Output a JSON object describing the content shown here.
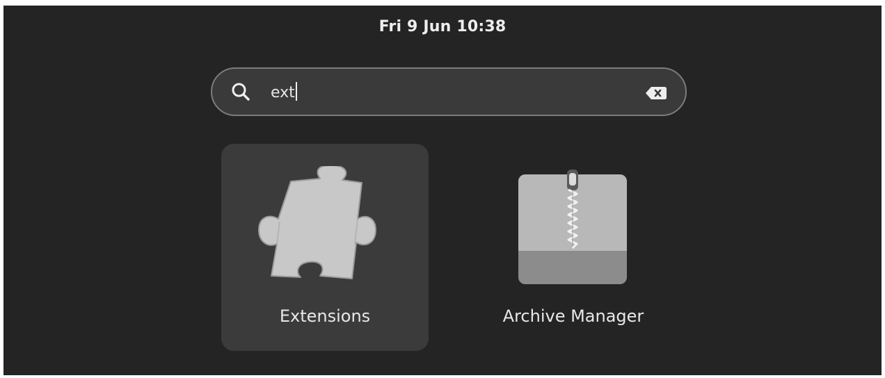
{
  "topbar": {
    "clock": "Fri 9 Jun  10:38"
  },
  "search": {
    "query": "ext",
    "search_icon": "search-icon",
    "clear_icon": "clear-text-icon"
  },
  "results": [
    {
      "label": "Extensions",
      "icon": "puzzle-piece-icon",
      "selected": true
    },
    {
      "label": "Archive Manager",
      "icon": "archive-zipper-icon",
      "selected": false
    }
  ],
  "colors": {
    "background": "#242424",
    "search_fill": "#3a3a3a",
    "search_border": "#7c7c7c",
    "selected_tile": "#3b3b3b",
    "text": "#e8e8e8"
  }
}
